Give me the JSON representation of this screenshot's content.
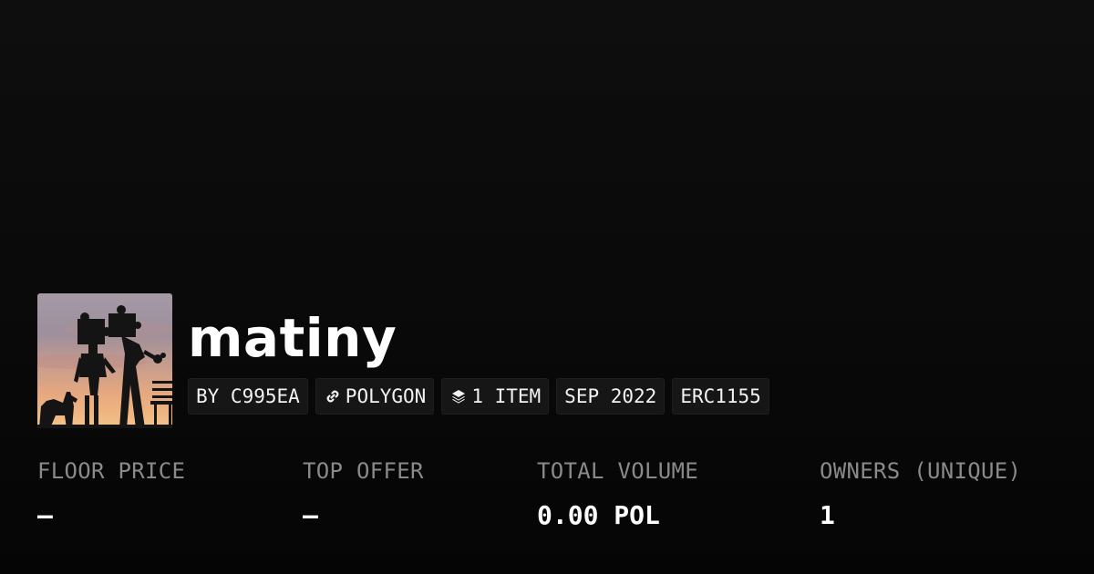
{
  "collection": {
    "name": "matiny",
    "avatar_alt": "matiny"
  },
  "tags": [
    {
      "label": "BY C995EA",
      "icon": ""
    },
    {
      "label": "POLYGON",
      "icon": "link-icon"
    },
    {
      "label": "1 ITEM",
      "icon": "layers-icon"
    },
    {
      "label": "SEP 2022",
      "icon": ""
    },
    {
      "label": "ERC1155",
      "icon": ""
    }
  ],
  "stats": [
    {
      "label": "FLOOR PRICE",
      "value": "–"
    },
    {
      "label": "TOP OFFER",
      "value": "–"
    },
    {
      "label": "TOTAL VOLUME",
      "value": "0.00 POL"
    },
    {
      "label": "OWNERS (UNIQUE)",
      "value": "1"
    }
  ],
  "colors": {
    "background": "#0b0b0b",
    "tag_background": "#161616",
    "label_gray": "#8a8a8a",
    "text": "#ffffff"
  }
}
